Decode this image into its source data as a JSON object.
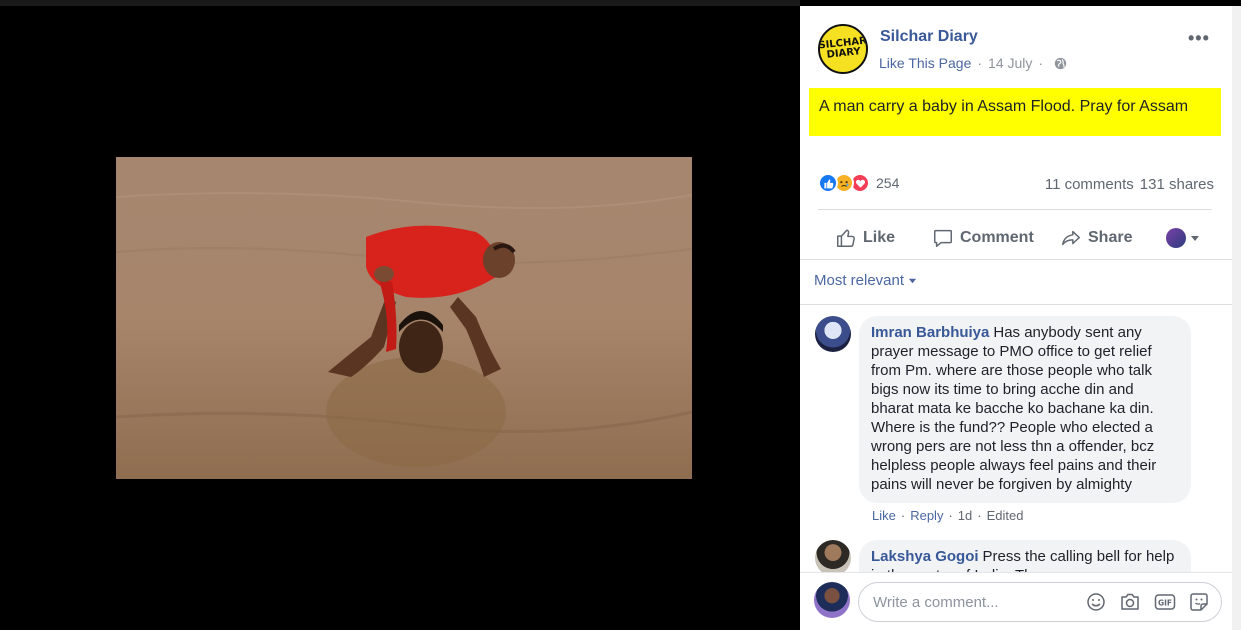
{
  "post": {
    "page_name": "Silchar Diary",
    "avatar_text": "SILCHAR DIARY",
    "like_page": "Like This Page",
    "date": "14 July",
    "separator": "·",
    "text": "A man carry a baby in Assam Flood. Pray for Assam"
  },
  "stats": {
    "reaction_count": "254",
    "comments": "11 comments",
    "shares": "131 shares"
  },
  "actions": {
    "like": "Like",
    "comment": "Comment",
    "share": "Share"
  },
  "sort": {
    "label": "Most relevant"
  },
  "comments": [
    {
      "author": "Imran Barbhuiya",
      "text": "Has anybody sent any prayer message to PMO office to get relief from Pm. where are those people who talk bigs now its time to bring acche din and bharat mata ke bacche ko bachane ka din. Where is the fund?? People who elected a wrong pers are not less thn a offender, bcz helpless people always feel pains and their pains will never be forgiven by almighty",
      "like": "Like",
      "reply": "Reply",
      "time": "1d",
      "edited": "Edited",
      "sep": "·"
    },
    {
      "author": "Lakshya Gogoi",
      "text": "Press the calling bell for help in the centre of India. The"
    }
  ],
  "composer": {
    "placeholder": "Write a comment..."
  },
  "colors": {
    "link_blue": "#385898",
    "highlight": "#ffff00",
    "like_reaction": "#1877f2",
    "sad_reaction": "#f7b125",
    "love_reaction": "#f33e58"
  },
  "icons": [
    "more-icon",
    "globe-icon",
    "like-reaction-icon",
    "sad-reaction-icon",
    "love-reaction-icon",
    "thumbs-up-icon",
    "comment-icon",
    "share-icon",
    "caret-down-icon",
    "emoji-icon",
    "camera-icon",
    "gif-icon",
    "sticker-icon"
  ]
}
